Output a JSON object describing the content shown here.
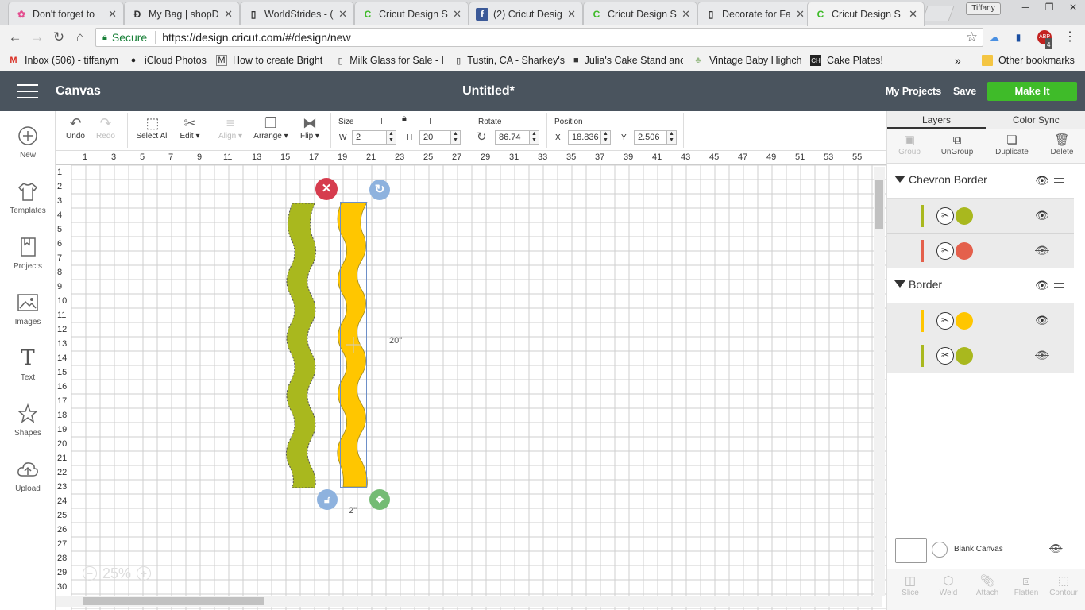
{
  "browser": {
    "tabs": [
      {
        "title": "Don't forget to",
        "icon": "flower-icon",
        "color": "#e34d8f"
      },
      {
        "title": "My Bag | shopD",
        "icon": "shop-icon",
        "color": "#222222"
      },
      {
        "title": "WorldStrides - (",
        "icon": "document-icon",
        "color": "#555555"
      },
      {
        "title": "Cricut Design S",
        "icon": "cricut-icon",
        "color": "#3fbb29"
      },
      {
        "title": "(2) Cricut Desig",
        "icon": "facebook-icon",
        "color": "#3b5998"
      },
      {
        "title": "Cricut Design S",
        "icon": "cricut-icon",
        "color": "#3fbb29"
      },
      {
        "title": "Decorate for Fa",
        "icon": "document-icon",
        "color": "#555555"
      },
      {
        "title": "Cricut Design S",
        "icon": "cricut-icon",
        "color": "#3fbb29",
        "active": true
      }
    ],
    "profile_name": "Tiffany",
    "secure_label": "Secure",
    "url": "https://design.cricut.com/#/design/new",
    "bookmarks": [
      {
        "label": "Inbox (506) - tiffanym",
        "icon": "gmail-icon"
      },
      {
        "label": "iCloud Photos",
        "icon": "apple-icon"
      },
      {
        "label": "How to create Bright",
        "icon": "image-icon"
      },
      {
        "label": "Milk Glass for Sale - I",
        "icon": "document-icon"
      },
      {
        "label": "Tustin, CA - Sharkey's",
        "icon": "document-icon"
      },
      {
        "label": "Julia's Cake Stand anc",
        "icon": "cube-icon"
      },
      {
        "label": "Vintage Baby Highch",
        "icon": "cupcake-icon"
      },
      {
        "label": "Cake Plates!",
        "icon": "ch-icon"
      }
    ],
    "other_bookmarks": "Other bookmarks",
    "extension_badge": "4"
  },
  "app": {
    "title": "Canvas",
    "document_title": "Untitled*",
    "my_projects": "My Projects",
    "save": "Save",
    "make_it": "Make It",
    "accent_color": "#3fbb29",
    "header_color": "#4a545e"
  },
  "left_panel": [
    {
      "label": "New",
      "icon": "plus-circle-icon"
    },
    {
      "label": "Templates",
      "icon": "shirt-icon"
    },
    {
      "label": "Projects",
      "icon": "projects-icon"
    },
    {
      "label": "Images",
      "icon": "image-icon"
    },
    {
      "label": "Text",
      "icon": "text-icon"
    },
    {
      "label": "Shapes",
      "icon": "shapes-icon"
    },
    {
      "label": "Upload",
      "icon": "upload-cloud-icon"
    }
  ],
  "toolbar": {
    "undo": "Undo",
    "redo": "Redo",
    "select_all": "Select All",
    "edit": "Edit",
    "align": "Align",
    "arrange": "Arrange",
    "flip": "Flip",
    "size_label": "Size",
    "w_label": "W",
    "w_value": "2",
    "h_label": "H",
    "h_value": "20",
    "rotate_label": "Rotate",
    "rotate_value": "86.74",
    "position_label": "Position",
    "x_label": "X",
    "x_value": "18.836",
    "y_label": "Y",
    "y_value": "2.506"
  },
  "canvas": {
    "ruler_top": [
      "1",
      "3",
      "5",
      "7",
      "9",
      "11",
      "13",
      "15",
      "17",
      "19",
      "21",
      "23",
      "25",
      "27",
      "29",
      "31",
      "33",
      "35",
      "37",
      "39",
      "41",
      "43",
      "45",
      "47",
      "49",
      "51",
      "53",
      "55"
    ],
    "ruler_left": [
      "1",
      "2",
      "3",
      "4",
      "5",
      "6",
      "7",
      "8",
      "9",
      "10",
      "11",
      "12",
      "13",
      "14",
      "15",
      "16",
      "17",
      "18",
      "19",
      "20",
      "21",
      "22",
      "23",
      "24",
      "25",
      "26",
      "27",
      "28",
      "29",
      "30"
    ],
    "height_label": "20\"",
    "width_label": "2\"",
    "zoom": "25%",
    "shape_green": "#a9b81e",
    "shape_yellow": "#ffc600"
  },
  "layers_panel": {
    "tab_layers": "Layers",
    "tab_color_sync": "Color Sync",
    "tools": [
      {
        "label": "Group",
        "icon": "group-icon",
        "enabled": false
      },
      {
        "label": "UnGroup",
        "icon": "ungroup-icon",
        "enabled": true
      },
      {
        "label": "Duplicate",
        "icon": "duplicate-icon",
        "enabled": true
      },
      {
        "label": "Delete",
        "icon": "trash-icon",
        "enabled": true
      }
    ],
    "groups": [
      {
        "name": "Chevron Border",
        "layers": [
          {
            "stroke": "#a9b81e",
            "swatch": "#a9b81e",
            "visible": true
          },
          {
            "stroke": "#e4604c",
            "swatch": "#e4604c",
            "visible": false
          }
        ]
      },
      {
        "name": "Border",
        "layers": [
          {
            "stroke": "#ffc600",
            "swatch": "#ffc600",
            "visible": true
          },
          {
            "stroke": "#a9b81e",
            "swatch": "#a9b81e",
            "visible": false
          }
        ]
      }
    ],
    "blank_canvas": "Blank Canvas",
    "bottom_tools": [
      "Slice",
      "Weld",
      "Attach",
      "Flatten",
      "Contour"
    ]
  }
}
